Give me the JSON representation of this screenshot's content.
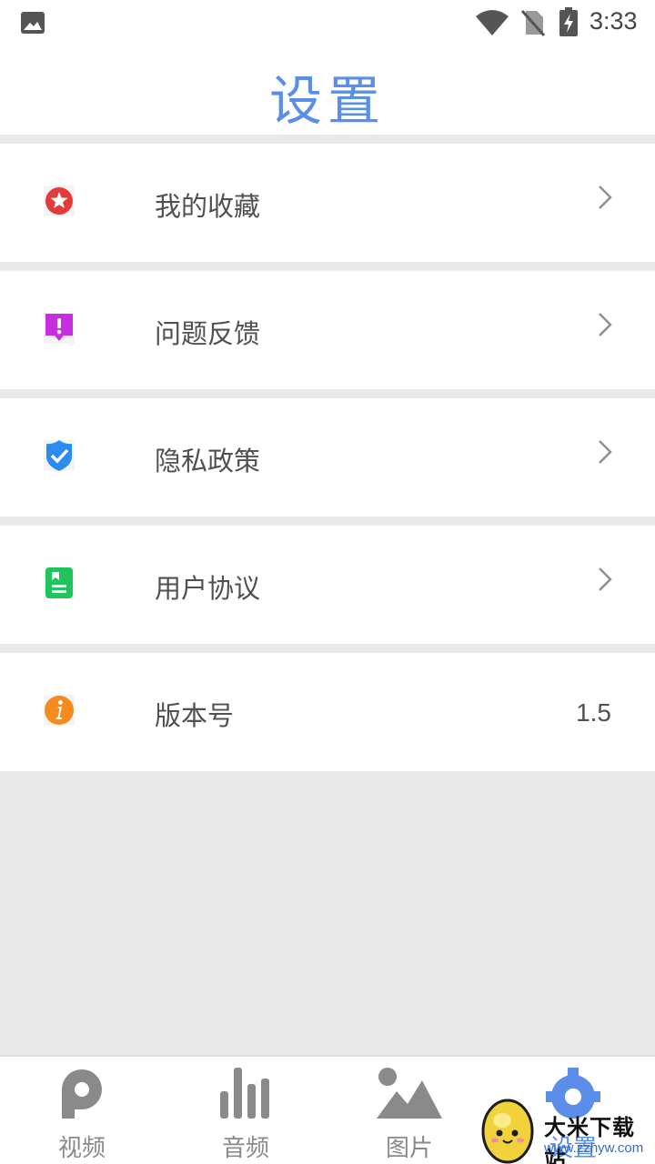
{
  "status_bar": {
    "time": "3:33"
  },
  "header": {
    "title": "设置"
  },
  "settings": [
    {
      "label": "我的收藏",
      "icon": "favorites-star-icon",
      "color": "#e23b3b"
    },
    {
      "label": "问题反馈",
      "icon": "feedback-alert-icon",
      "color": "#c62ee0"
    },
    {
      "label": "隐私政策",
      "icon": "privacy-shield-icon",
      "color": "#2a8cf0"
    },
    {
      "label": "用户协议",
      "icon": "agreement-document-icon",
      "color": "#1fc55a"
    },
    {
      "label": "版本号",
      "icon": "info-icon",
      "color": "#f58a1e",
      "value": "1.5"
    }
  ],
  "tabs": [
    {
      "label": "视频",
      "icon": "video-p-icon"
    },
    {
      "label": "音频",
      "icon": "audio-bars-icon"
    },
    {
      "label": "图片",
      "icon": "image-mountain-icon"
    },
    {
      "label": "设置",
      "icon": "settings-gear-icon",
      "active": true
    }
  ],
  "watermark": {
    "name": "大米下载站",
    "url": "www.zzhyw.com"
  },
  "colors": {
    "accent": "#5b8ee8",
    "background": "#e9e9e9",
    "tab_inactive": "#8a8a8a"
  }
}
